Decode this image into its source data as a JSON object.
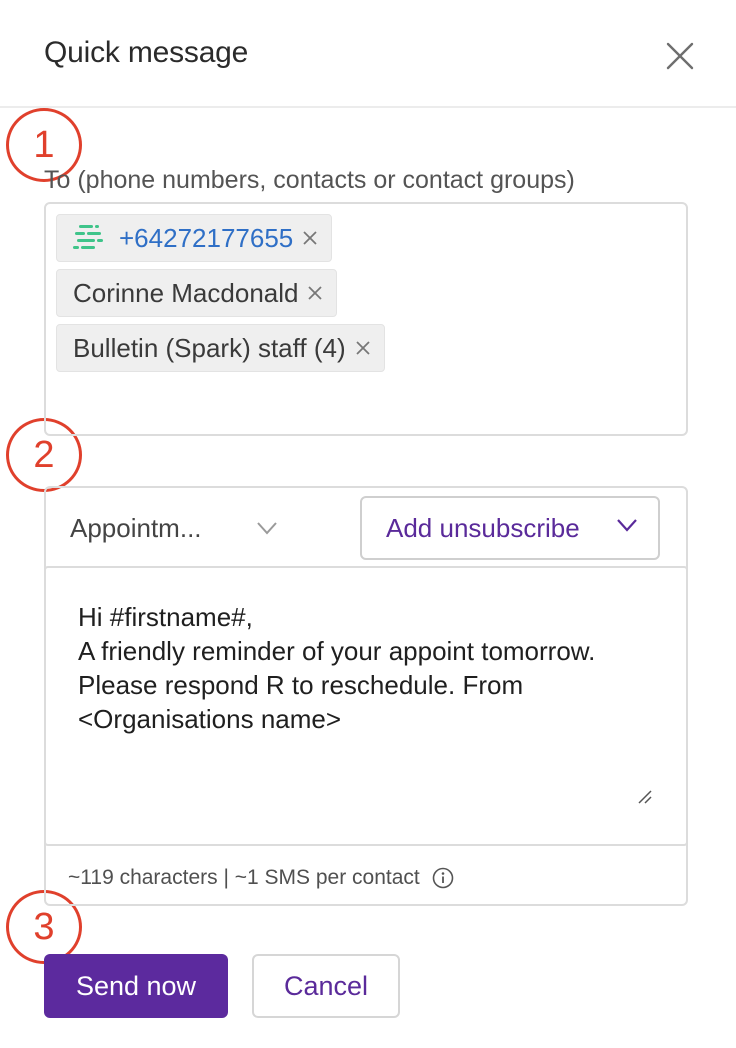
{
  "header": {
    "title": "Quick message"
  },
  "steps": [
    "1",
    "2",
    "3"
  ],
  "recipients": {
    "label": "To (phone numbers, contacts or contact groups)",
    "chips": [
      {
        "text": "+64272177655",
        "kind": "phone",
        "icon": "app-logo-icon"
      },
      {
        "text": "Corinne Macdonald",
        "kind": "contact"
      },
      {
        "text": "Bulletin (Spark) staff (4)",
        "kind": "group"
      }
    ]
  },
  "compose": {
    "template_value": "Appointm...",
    "unsubscribe_label": "Add unsubscribe",
    "message": "Hi #firstname#,\nA friendly reminder of your appoint tomorrow.\nPlease respond R to reschedule. From\n<Organisations name>",
    "counter": "~119 characters | ~1 SMS per contact"
  },
  "actions": {
    "send_label": "Send now",
    "cancel_label": "Cancel"
  },
  "colors": {
    "accent": "#5c2a9e",
    "annotation": "#e0402c",
    "link": "#2f6fc6",
    "logo": "#3fc48a"
  }
}
